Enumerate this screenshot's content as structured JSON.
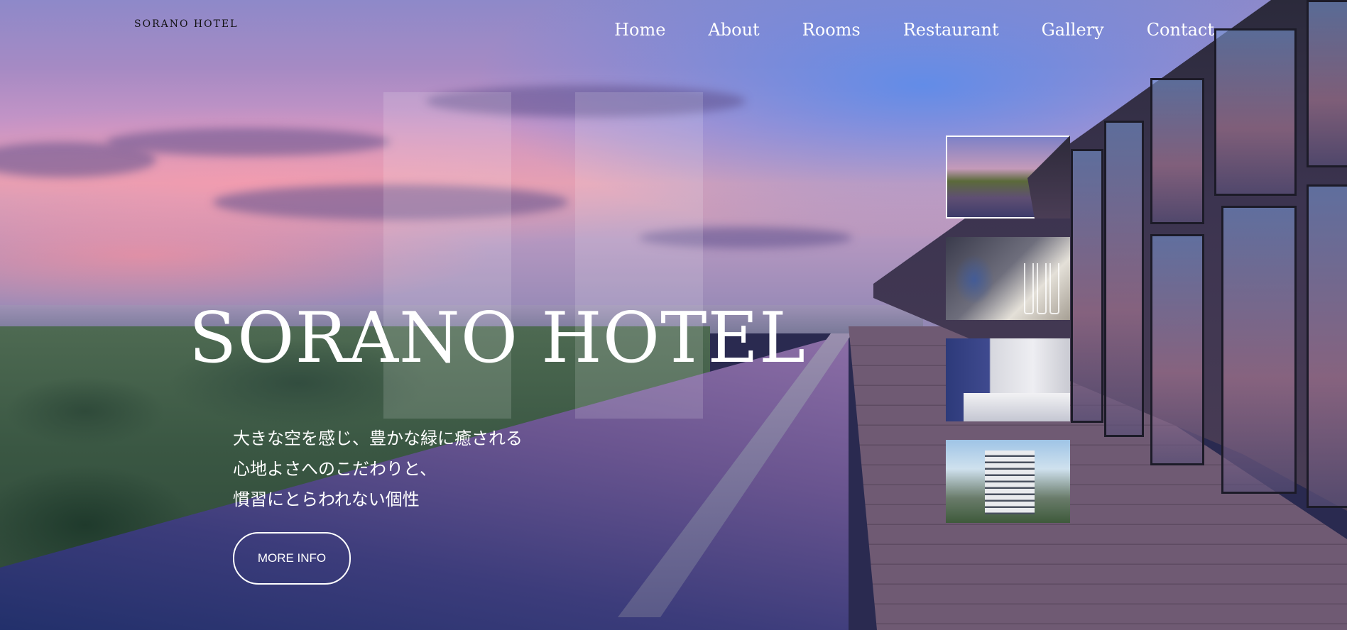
{
  "header": {
    "logo": "SORANO HOTEL",
    "nav": [
      "Home",
      "About",
      "Rooms",
      "Restaurant",
      "Gallery",
      "Contact"
    ]
  },
  "hero": {
    "title": "SORANO HOTEL",
    "tagline": [
      "大きな空を感じ、豊かな緑に癒される",
      "心地よさへのこだわりと、",
      "慣習にとらわれない個性"
    ],
    "button": "MORE INFO"
  },
  "gallery": {
    "thumbnails": [
      "rooftop-pool-thumb",
      "wine-glasses-thumb",
      "guest-room-thumb",
      "hotel-exterior-thumb"
    ],
    "active_index": 0
  }
}
